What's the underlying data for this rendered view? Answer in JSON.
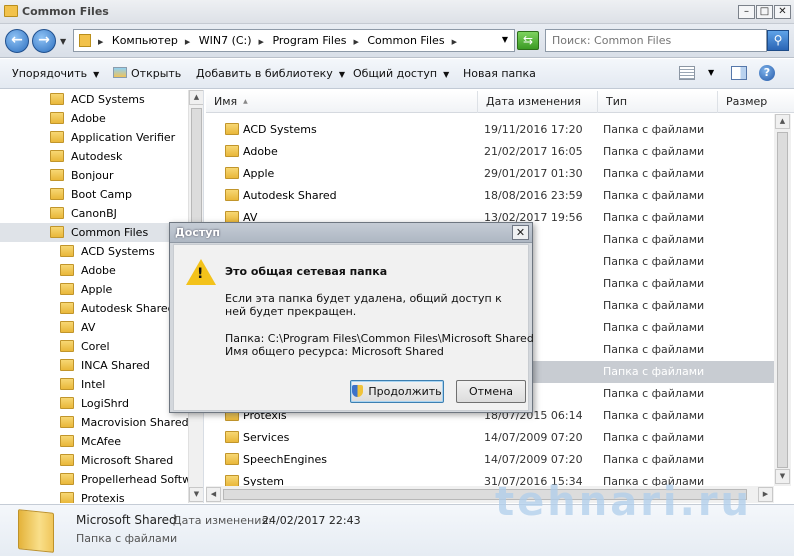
{
  "window": {
    "title": "Common Files"
  },
  "address": {
    "crumbs": [
      "Компьютер",
      "WIN7 (C:)",
      "Program Files",
      "Common Files"
    ],
    "search_placeholder": "Поиск: Common Files"
  },
  "toolbar": {
    "organize": "Упорядочить",
    "open": "Открыть",
    "add_library": "Добавить в библиотеку",
    "share": "Общий доступ",
    "new_folder": "Новая папка"
  },
  "nav": {
    "top_items": [
      "ACD Systems",
      "Adobe",
      "Application Verifier",
      "Autodesk",
      "Bonjour",
      "Boot Camp",
      "CanonBJ"
    ],
    "selected": "Common Files",
    "children": [
      "ACD Systems",
      "Adobe",
      "Apple",
      "Autodesk Shared",
      "AV",
      "Corel",
      "INCA Shared",
      "Intel",
      "LogiShrd",
      "Macrovision Shared",
      "McAfee",
      "Microsoft Shared",
      "Propellerhead Softwar",
      "Protexis"
    ]
  },
  "columns": {
    "name": "Имя",
    "date": "Дата изменения",
    "type": "Тип",
    "size": "Размер"
  },
  "files": [
    {
      "name": "ACD Systems",
      "date": "19/11/2016 17:20",
      "type": "Папка с файлами"
    },
    {
      "name": "Adobe",
      "date": "21/02/2017 16:05",
      "type": "Папка с файлами"
    },
    {
      "name": "Apple",
      "date": "29/01/2017 01:30",
      "type": "Папка с файлами"
    },
    {
      "name": "Autodesk Shared",
      "date": "18/08/2016 23:59",
      "type": "Папка с файлами"
    },
    {
      "name": "AV",
      "date": "13/02/2017 19:56",
      "type": "Папка с файлами"
    },
    {
      "name": "",
      "date": "7 17:41",
      "type": "Папка с файлами"
    },
    {
      "name": "",
      "date": "15 15:37",
      "type": "Папка с файлами"
    },
    {
      "name": "",
      "date": "16 10:13",
      "type": "Папка с файлами"
    },
    {
      "name": "",
      "date": "16 19:03",
      "type": "Папка с файлами"
    },
    {
      "name": "",
      "date": "15 13:23",
      "type": "Папка с файлами"
    },
    {
      "name": "",
      "date": "17 03:16",
      "type": "Папка с файлами"
    },
    {
      "name": "",
      "date": "7 22:43",
      "type": "Папка с файлами"
    },
    {
      "name": "",
      "date": "15 09:07",
      "type": "Папка с файлами"
    },
    {
      "name": "Protexis",
      "date": "18/07/2015 06:14",
      "type": "Папка с файлами"
    },
    {
      "name": "Services",
      "date": "14/07/2009 07:20",
      "type": "Папка с файлами"
    },
    {
      "name": "SpeechEngines",
      "date": "14/07/2009 07:20",
      "type": "Папка с файлами"
    },
    {
      "name": "System",
      "date": "31/07/2016 15:34",
      "type": "Папка с файлами"
    }
  ],
  "details": {
    "name": "Microsoft Shared",
    "modified_label": "Дата изменения:",
    "modified": "24/02/2017 22:43",
    "type": "Папка с файлами"
  },
  "dialog": {
    "title": "Доступ",
    "heading": "Это общая сетевая папка",
    "text": "Если эта папка будет удалена, общий доступ к ней будет прекращен.",
    "folder_line": "Папка:  C:\\Program Files\\Common Files\\Microsoft Shared",
    "share_line": "Имя общего ресурса:  Microsoft Shared",
    "continue": "Продолжить",
    "cancel": "Отмена"
  },
  "watermark": "tehnari.ru"
}
